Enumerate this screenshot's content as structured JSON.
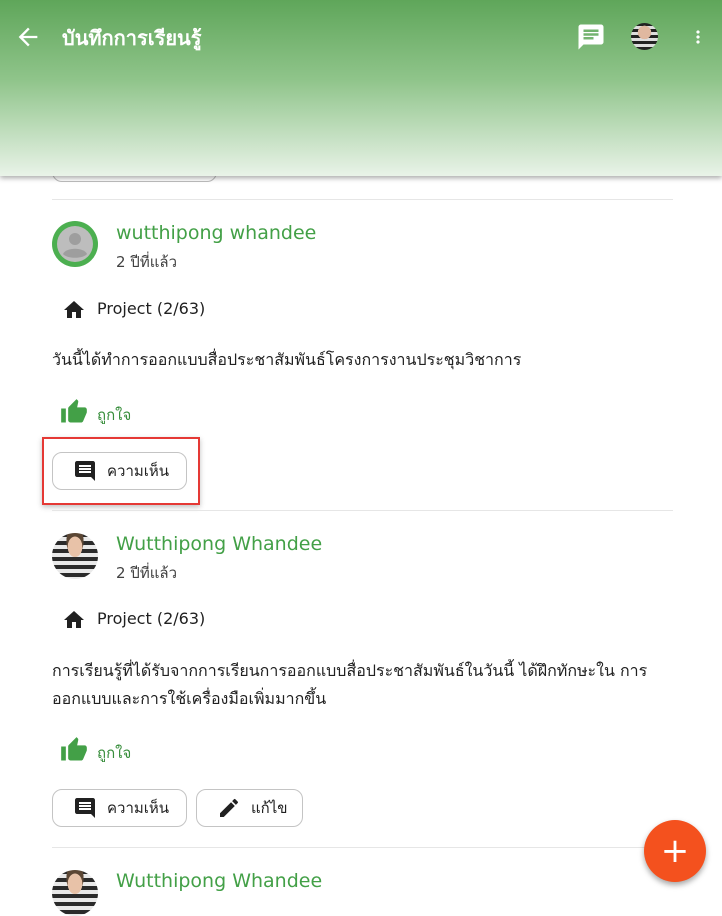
{
  "app_bar": {
    "title": "บันทึกการเรียนรู้",
    "back_icon": "arrow-back-icon",
    "chat_icon": "chat-icon",
    "more_icon": "more-vert-icon",
    "color": "#5fa65a"
  },
  "posts": [
    {
      "author": "wutthipong whandee",
      "time": "2 ปีที่แล้ว",
      "project": "Project (2/63)",
      "body": "วันนี้ได้ทำการออกแบบสื่อประชาสัมพันธ์โครงการงานประชุมวิชาการ",
      "like_label": "ถูกใจ",
      "comment_label": "ความเห็น"
    },
    {
      "author": "Wutthipong Whandee",
      "time": "2 ปีที่แล้ว",
      "project": "Project (2/63)",
      "body": "การเรียนรู้ที่ได้รับจากการเรียนการออกแบบสื่อประชาสัมพันธ์ในวันนี้ ได้ฝึกทักษะใน การออกแบบและการใช้เครื่องมือเพิ่มมากขึ้น",
      "like_label": "ถูกใจ",
      "comment_label": "ความเห็น",
      "edit_label": "แก้ไข"
    },
    {
      "author": "Wutthipong Whandee"
    }
  ],
  "fab": {
    "label": "+",
    "color": "#f4511e"
  },
  "accent": "#43a047"
}
